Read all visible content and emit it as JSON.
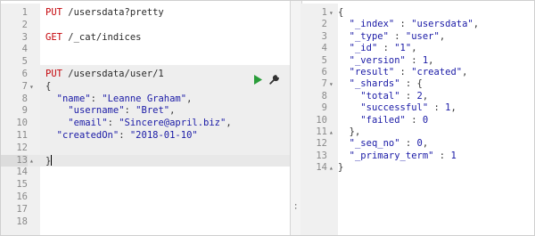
{
  "request_editor": {
    "lines": [
      {
        "n": "1",
        "parts": [
          [
            "kw",
            "PUT"
          ],
          [
            "url",
            " /usersdata?pretty"
          ]
        ]
      },
      {
        "n": "2",
        "parts": []
      },
      {
        "n": "3",
        "parts": [
          [
            "kw",
            "GET"
          ],
          [
            "url",
            " /_cat/indices"
          ]
        ]
      },
      {
        "n": "4",
        "parts": []
      },
      {
        "n": "5",
        "parts": []
      },
      {
        "n": "6",
        "parts": [
          [
            "kw",
            "PUT"
          ],
          [
            "url",
            " /usersdata/user/1"
          ]
        ]
      },
      {
        "n": "7",
        "parts": [
          [
            "punct",
            "{"
          ]
        ],
        "fold": "▾"
      },
      {
        "n": "8",
        "parts": [
          [
            "punct",
            "  "
          ],
          [
            "key",
            "\"name\""
          ],
          [
            "punct",
            ": "
          ],
          [
            "str",
            "\"Leanne Graham\""
          ],
          [
            "punct",
            ","
          ]
        ]
      },
      {
        "n": "9",
        "parts": [
          [
            "punct",
            "    "
          ],
          [
            "key",
            "\"username\""
          ],
          [
            "punct",
            ": "
          ],
          [
            "str",
            "\"Bret\""
          ],
          [
            "punct",
            ","
          ]
        ]
      },
      {
        "n": "10",
        "parts": [
          [
            "punct",
            "    "
          ],
          [
            "key",
            "\"email\""
          ],
          [
            "punct",
            ": "
          ],
          [
            "str",
            "\"Sincere@april.biz\""
          ],
          [
            "punct",
            ","
          ]
        ]
      },
      {
        "n": "11",
        "parts": [
          [
            "punct",
            "  "
          ],
          [
            "key",
            "\"createdOn\""
          ],
          [
            "punct",
            ": "
          ],
          [
            "str",
            "\"2018-01-10\""
          ]
        ]
      },
      {
        "n": "12",
        "parts": []
      },
      {
        "n": "13",
        "parts": [
          [
            "punct",
            "}"
          ]
        ],
        "fold": "▴",
        "active": true,
        "cursor": true
      },
      {
        "n": "14",
        "parts": []
      },
      {
        "n": "15",
        "parts": []
      },
      {
        "n": "16",
        "parts": []
      },
      {
        "n": "17",
        "parts": []
      },
      {
        "n": "18",
        "parts": []
      }
    ]
  },
  "response_viewer": {
    "lines": [
      {
        "n": "1",
        "parts": [
          [
            "punct",
            "{"
          ]
        ],
        "fold": "▾"
      },
      {
        "n": "2",
        "parts": [
          [
            "punct",
            "  "
          ],
          [
            "key",
            "\"_index\""
          ],
          [
            "punct",
            " : "
          ],
          [
            "str",
            "\"usersdata\""
          ],
          [
            "punct",
            ","
          ]
        ]
      },
      {
        "n": "3",
        "parts": [
          [
            "punct",
            "  "
          ],
          [
            "key",
            "\"_type\""
          ],
          [
            "punct",
            " : "
          ],
          [
            "str",
            "\"user\""
          ],
          [
            "punct",
            ","
          ]
        ]
      },
      {
        "n": "4",
        "parts": [
          [
            "punct",
            "  "
          ],
          [
            "key",
            "\"_id\""
          ],
          [
            "punct",
            " : "
          ],
          [
            "str",
            "\"1\""
          ],
          [
            "punct",
            ","
          ]
        ]
      },
      {
        "n": "5",
        "parts": [
          [
            "punct",
            "  "
          ],
          [
            "key",
            "\"_version\""
          ],
          [
            "punct",
            " : "
          ],
          [
            "num-v",
            "1"
          ],
          [
            "punct",
            ","
          ]
        ]
      },
      {
        "n": "6",
        "parts": [
          [
            "punct",
            "  "
          ],
          [
            "key",
            "\"result\""
          ],
          [
            "punct",
            " : "
          ],
          [
            "str",
            "\"created\""
          ],
          [
            "punct",
            ","
          ]
        ]
      },
      {
        "n": "7",
        "parts": [
          [
            "punct",
            "  "
          ],
          [
            "key",
            "\"_shards\""
          ],
          [
            "punct",
            " : {"
          ]
        ],
        "fold": "▾"
      },
      {
        "n": "8",
        "parts": [
          [
            "punct",
            "    "
          ],
          [
            "key",
            "\"total\""
          ],
          [
            "punct",
            " : "
          ],
          [
            "num-v",
            "2"
          ],
          [
            "punct",
            ","
          ]
        ]
      },
      {
        "n": "9",
        "parts": [
          [
            "punct",
            "    "
          ],
          [
            "key",
            "\"successful\""
          ],
          [
            "punct",
            " : "
          ],
          [
            "num-v",
            "1"
          ],
          [
            "punct",
            ","
          ]
        ]
      },
      {
        "n": "10",
        "parts": [
          [
            "punct",
            "    "
          ],
          [
            "key",
            "\"failed\""
          ],
          [
            "punct",
            " : "
          ],
          [
            "num-v",
            "0"
          ]
        ]
      },
      {
        "n": "11",
        "parts": [
          [
            "punct",
            "  },"
          ]
        ],
        "fold": "▴"
      },
      {
        "n": "12",
        "parts": [
          [
            "punct",
            "  "
          ],
          [
            "key",
            "\"_seq_no\""
          ],
          [
            "punct",
            " : "
          ],
          [
            "num-v",
            "0"
          ],
          [
            "punct",
            ","
          ]
        ]
      },
      {
        "n": "13",
        "parts": [
          [
            "punct",
            "  "
          ],
          [
            "key",
            "\"_primary_term\""
          ],
          [
            "punct",
            " : "
          ],
          [
            "num-v",
            "1"
          ]
        ]
      },
      {
        "n": "14",
        "parts": [
          [
            "punct",
            "}"
          ]
        ],
        "fold": "▴"
      }
    ]
  },
  "icons": {
    "run": "play-icon",
    "settings": "wrench-icon",
    "resize": "grip-icon"
  },
  "colors": {
    "method": "#c5060b",
    "json_value": "#1a1aa6",
    "run_button": "#2a9d3a",
    "gutter": "#f0f0f0",
    "request_block_bg": "#eeeeee"
  }
}
